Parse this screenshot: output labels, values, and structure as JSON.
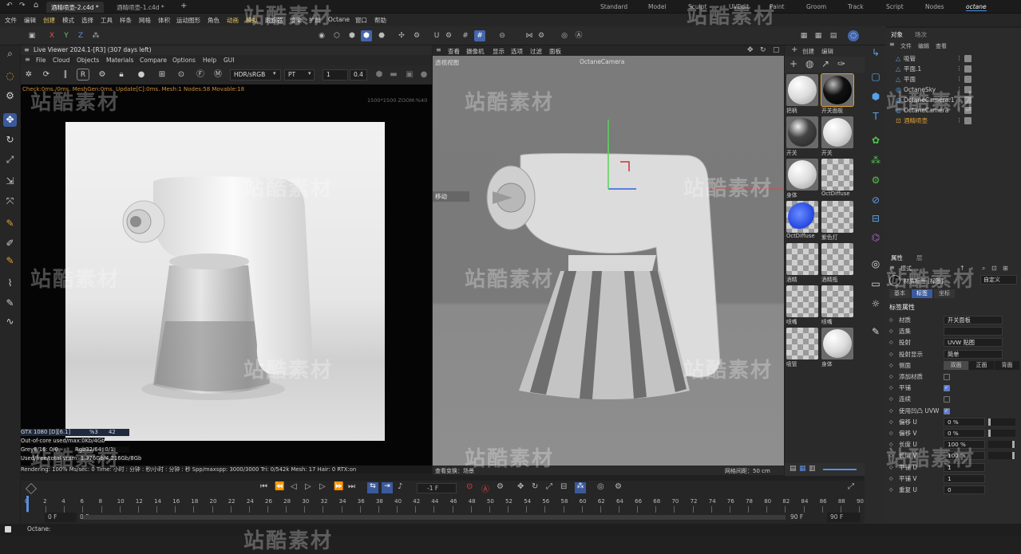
{
  "titlebar": {
    "tabs": [
      "酒精喷壶-2.c4d *",
      "酒精喷壶-1.c4d *"
    ],
    "layouts": [
      "Standard",
      "Model",
      "Sculpt",
      "UVEdit",
      "Paint",
      "Groom",
      "Track",
      "Script",
      "Nodes",
      "octane"
    ]
  },
  "menubar": [
    "文件",
    "编辑",
    "创建",
    "模式",
    "选择",
    "工具",
    "样条",
    "网格",
    "体积",
    "运动图形",
    "角色",
    "动画",
    "模拟",
    "跟踪器",
    "渲染",
    "扩展",
    "Octane",
    "窗口",
    "帮助"
  ],
  "toolbar": {
    "axes": [
      "X",
      "Y",
      "Z"
    ]
  },
  "liveviewer": {
    "title": "Live Viewer 2024.1-[R3] (307 days left)",
    "menu": [
      "File",
      "Cloud",
      "Objects",
      "Materials",
      "Compare",
      "Options",
      "Help",
      "GUI"
    ],
    "colorspace": "HDR/sRGB",
    "kernel": "PT",
    "value1": "1",
    "value2": "0.4",
    "info": "Check:0ms./0ms. MeshGen:0ms. Update[C]:0ms. Mesh:1 Nodes:58 Movable:18",
    "resolution": "1500*1500 ZOOM:%40",
    "gpu": "GTX 1080 [D][6.1]",
    "gpu_pct": "%3",
    "gpu_temp": "42",
    "outofcore": "Out-of-core used/max:0Kb/4Gb",
    "grey": "Grey8/16: 0/0",
    "rgb": "Rgb32/64: 0/1",
    "vram": "Used/free/total vram: 1.376Gb/4.216Gb/8Gb",
    "status": "Rendering: 100%   Ms/sec: 0   Time: 小时 : 分钟 : 秒/小时 : 分钟 : 秒   Spp/maxspp: 3000/3000   Tri: 0/542k   Mesh: 17   Hair: 0   RTX:on"
  },
  "viewport": {
    "menu": [
      "查看",
      "摄像机",
      "显示",
      "选项",
      "过滤",
      "面板"
    ],
    "label": "透视视图",
    "camera": "OctaneCamera",
    "move_label": "移动",
    "bottom_left": "查看变换：场景",
    "bottom_right": "网格间距：50 cm"
  },
  "materials": {
    "menu": [
      "创建",
      "编辑"
    ],
    "items": [
      {
        "name": "把柄",
        "kind": "white"
      },
      {
        "name": "开关面板",
        "kind": "black"
      },
      {
        "name": "开关",
        "kind": "dark"
      },
      {
        "name": "开关",
        "kind": "white"
      },
      {
        "name": "身体",
        "kind": "white"
      },
      {
        "name": "OctDiffuse",
        "kind": "checker"
      },
      {
        "name": "OctDiffuse",
        "kind": "blue"
      },
      {
        "name": "紫色灯",
        "kind": "checker"
      },
      {
        "name": "酒精",
        "kind": "checker"
      },
      {
        "name": "酒精瓶",
        "kind": "checker"
      },
      {
        "name": "喷嘴",
        "kind": "checker"
      },
      {
        "name": "喷嘴",
        "kind": "checker"
      },
      {
        "name": "吸管",
        "kind": "checker"
      },
      {
        "name": "身体",
        "kind": "white"
      }
    ]
  },
  "objects": {
    "tabs": [
      "对象",
      "场次"
    ],
    "menu": [
      "文件",
      "编辑",
      "查看"
    ],
    "items": [
      "吸管",
      "平面.1",
      "平面",
      "OctaneSky",
      "OctaneCamera.1",
      "OctaneCamera",
      "酒精喷壶"
    ]
  },
  "attributes": {
    "tabs": [
      "属性",
      "层"
    ],
    "mode": "模式",
    "custom": "自定义",
    "object_name": "材质标签 [标签]",
    "subtabs": [
      "基本",
      "标签",
      "坐标"
    ],
    "section": "标签属性",
    "rows": [
      {
        "label": "材质",
        "value": "开关面板"
      },
      {
        "label": "选集",
        "value": ""
      },
      {
        "label": "投射",
        "value": "UVW 贴图"
      },
      {
        "label": "投射显示",
        "value": "简单"
      },
      {
        "label": "侧面",
        "value": "双面"
      },
      {
        "label": "添加材质",
        "value": ""
      },
      {
        "label": "平铺",
        "value": ""
      },
      {
        "label": "连续",
        "value": ""
      },
      {
        "label": "使用凹凸 UVW",
        "value": ""
      },
      {
        "label": "偏移 U",
        "value": "0 %"
      },
      {
        "label": "偏移 V",
        "value": "0 %"
      },
      {
        "label": "长度 U",
        "value": "100 %"
      },
      {
        "label": "长度 V",
        "value": "100 %"
      },
      {
        "label": "平铺 U",
        "value": "1"
      },
      {
        "label": "平铺 V",
        "value": "1"
      },
      {
        "label": "重复 U",
        "value": "0"
      }
    ],
    "side_options": [
      "双面",
      "正面",
      "背面"
    ],
    "checkbox_states": [
      false,
      true,
      false,
      true
    ]
  },
  "timeline": {
    "frame_field": "-1 F",
    "ticks": [
      "0",
      "2",
      "4",
      "6",
      "8",
      "10",
      "12",
      "14",
      "16",
      "18",
      "20",
      "22",
      "24",
      "26",
      "28",
      "30",
      "32",
      "34",
      "36",
      "38",
      "40",
      "42",
      "44",
      "46",
      "48",
      "50",
      "52",
      "54",
      "56",
      "58",
      "60",
      "62",
      "64",
      "66",
      "68",
      "70",
      "72",
      "74",
      "76",
      "78",
      "80",
      "82",
      "84",
      "86",
      "88",
      "90"
    ],
    "start": "0 F",
    "start2": "0 F",
    "end": "90 F",
    "end2": "90 F"
  },
  "statusbar": {
    "text": "Octane:"
  },
  "watermark": "站酷素材"
}
